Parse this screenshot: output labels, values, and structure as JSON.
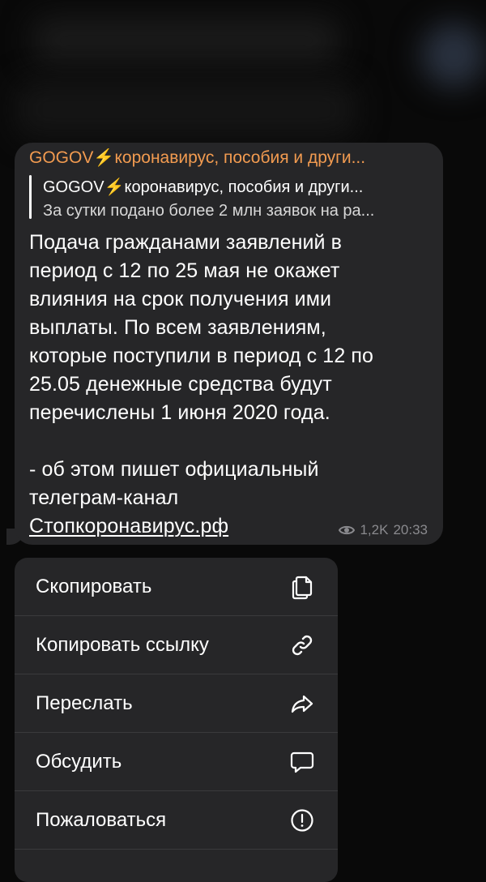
{
  "message": {
    "sender": "GOGOV⚡️коронавирус, пособия и други...",
    "reply_title": "GOGOV⚡️коронавирус, пособия и други...",
    "reply_text": "За сутки подано более 2 млн заявок на ра...",
    "lines": [
      "Подача гражданами заявлений в",
      "период с 12 по 25 мая не окажет",
      "влияния на срок получения ими",
      "выплаты. По всем заявлениям,",
      "которые поступили в период с 12 по",
      "25.05 денежные средства будут",
      "перечислены 1 июня 2020 года."
    ],
    "lines2": [
      "- об этом пишет официальный",
      "телеграм-канал"
    ],
    "link": "Стопкоронавирус.рф",
    "views": "1,2K",
    "time": "20:33"
  },
  "menu": {
    "items": [
      {
        "label": "Скопировать",
        "icon": "copy-icon"
      },
      {
        "label": "Копировать ссылку",
        "icon": "link-icon"
      },
      {
        "label": "Переслать",
        "icon": "forward-icon"
      },
      {
        "label": "Обсудить",
        "icon": "comment-icon"
      },
      {
        "label": "Пожаловаться",
        "icon": "report-icon"
      }
    ]
  },
  "colors": {
    "background": "#090909",
    "bubble": "#262628",
    "sender": "#f29b50",
    "meta": "#8a8a8e"
  }
}
